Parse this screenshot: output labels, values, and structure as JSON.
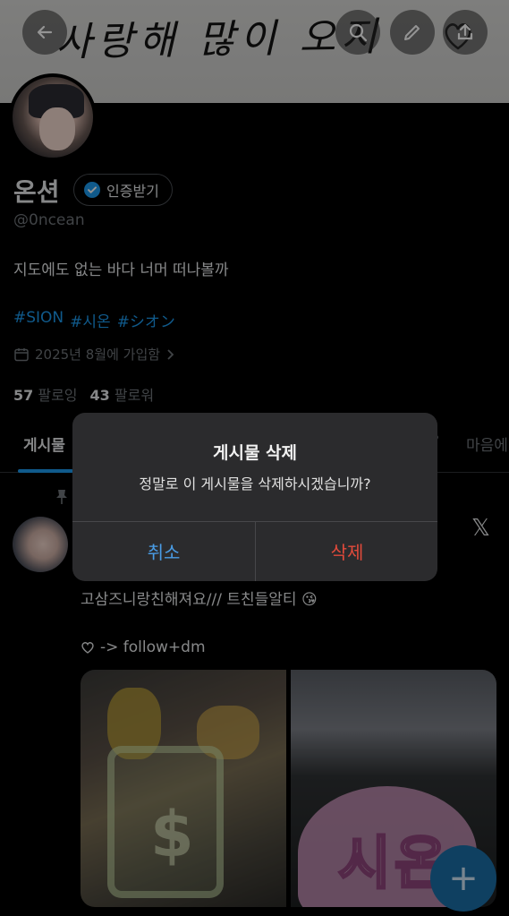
{
  "banner": {
    "text": "사랑해 많이 오지"
  },
  "profile": {
    "name": "온션",
    "verify_label": "인증받기",
    "handle": "@0ncean",
    "bio": "지도에도 없는 바다 너머 떠나볼까",
    "hashtags": [
      "#SION",
      "#시온",
      "#シオン"
    ],
    "joined": "2025년 8월에 가입함",
    "following_count": "57",
    "following_label": "팔로잉",
    "followers_count": "43",
    "followers_label": "팔로워"
  },
  "tabs": {
    "posts": "게시물",
    "likes": "마음에",
    "partial_middle": "?"
  },
  "post": {
    "line1": "고삼즈니랑친해져요/// 트친들알티",
    "line2": "-> follow+dm",
    "image_right_text": "시온"
  },
  "dialog": {
    "title": "게시물 삭제",
    "message": "정말로 이 게시물을 삭제하시겠습니까?",
    "cancel_label": "취소",
    "delete_label": "삭제"
  },
  "colors": {
    "accent": "#1d9bf0",
    "delete": "#e24a3b",
    "cancel": "#4a9de6"
  },
  "icons": {
    "fab": "plus-icon",
    "brand": "x-logo-icon"
  }
}
